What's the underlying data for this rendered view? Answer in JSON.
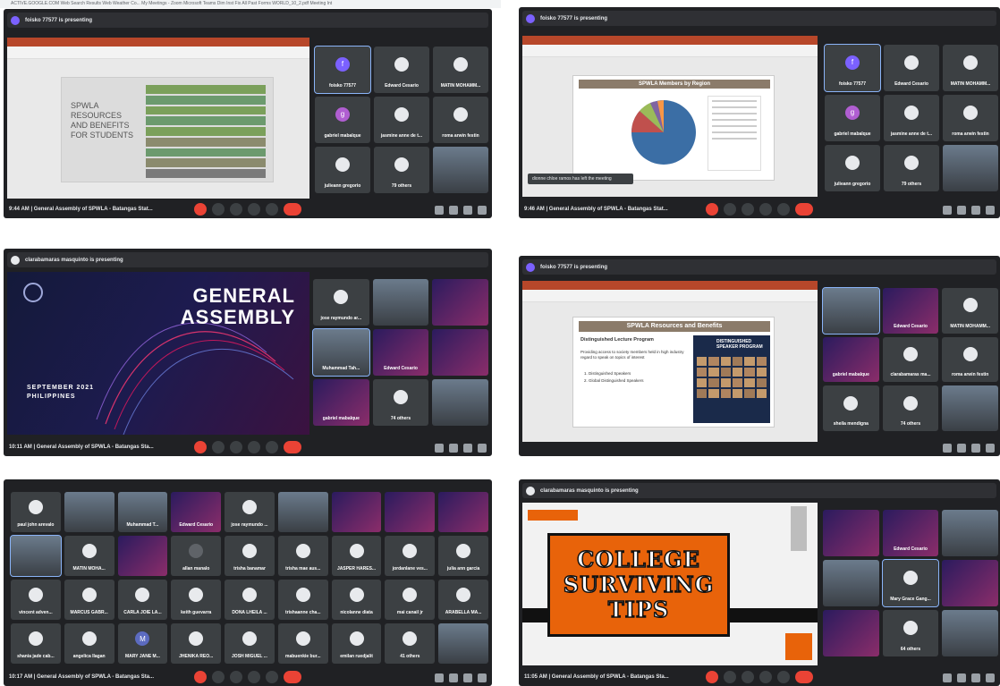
{
  "bookmarks_bar": {
    "text": "ACTIVE.GOOGLE.COM    Web Search Results    Web Weather Co...    My Meetings - Zoom    Microsoft Teams    Dim Inst    Fix All Past Forms    WORLD_10_2.pdf    Meeting Int"
  },
  "panels": [
    {
      "presenter": "foisko 77577 is presenting",
      "time_title": "9:44 AM  |  General Assembly of SPWLA - Batangas Stat...",
      "slide_title": "SPWLA RESOURCES AND BENEFITS FOR STUDENTS",
      "participants": [
        {
          "name": "foisko 77577",
          "letter": "f"
        },
        {
          "name": "Edward Cesario"
        },
        {
          "name": "MATIN MOHAMM..."
        },
        {
          "name": "gabriel mabalque",
          "letter": "g"
        },
        {
          "name": "jasmine anne de t..."
        },
        {
          "name": "roma arwin festin"
        },
        {
          "name": "julieann gregorio"
        },
        {
          "name": "79 others"
        },
        {
          "name": ""
        }
      ]
    },
    {
      "presenter": "foisko 77577 is presenting",
      "time_title": "9:46 AM  |  General Assembly of SPWLA - Batangas Stat...",
      "slide_title": "SPWLA Members by Region",
      "snackbar": "dionne chloe ramos has left the meeting",
      "participants": [
        {
          "name": "foisko 77577",
          "letter": "f"
        },
        {
          "name": "Edward Cesario"
        },
        {
          "name": "MATIN MOHAMM..."
        },
        {
          "name": "gabriel mabalque",
          "letter": "g"
        },
        {
          "name": "jasmine anne de t..."
        },
        {
          "name": "roma arwin festin"
        },
        {
          "name": "julieann gregorio"
        },
        {
          "name": "79 others"
        },
        {
          "name": ""
        }
      ]
    },
    {
      "presenter": "clarabamaras masquinto is presenting",
      "time_title": "10:11 AM  |  General Assembly of SPWLA - Batangas Sta...",
      "slide_title_1": "GENERAL",
      "slide_title_2": "ASSEMBLY",
      "slide_date": "SEPTEMBER 2021",
      "slide_place": "PHILIPPINES",
      "participants": [
        {
          "name": "jose raymundo ar..."
        },
        {
          "name": ""
        },
        {
          "name": ""
        },
        {
          "name": "Muhammad Tah..."
        },
        {
          "name": "Edward Cesario"
        },
        {
          "name": ""
        },
        {
          "name": "gabriel mabalque"
        },
        {
          "name": "74 others"
        },
        {
          "name": ""
        }
      ]
    },
    {
      "presenter": "foisko 77577 is presenting",
      "time_title": "",
      "slide_title": "SPWLA Resources and Benefits",
      "slide_subtitle": "Distinguished Lecture Program",
      "slide_body": "Providing access to society members held in high industry regard to speak on topics of interest",
      "slide_items": [
        "1. Distinguished Speakers",
        "2. Global Distinguished Speakers"
      ],
      "slide_image_title": "DISTINGUISHED SPEAKER PROGRAM",
      "participants": [
        {
          "name": ""
        },
        {
          "name": "Edward Cesario"
        },
        {
          "name": "MATIN MOHAMM..."
        },
        {
          "name": "gabriel mabalque"
        },
        {
          "name": "clarabamaras ma..."
        },
        {
          "name": "roma arwin festin"
        },
        {
          "name": "sheila mendigna"
        },
        {
          "name": "74 others"
        },
        {
          "name": ""
        }
      ]
    },
    {
      "presenter": "",
      "time_title": "10:17 AM  |  General Assembly of SPWLA - Batangas Sta...",
      "participants": [
        {
          "name": "paul john arevalo"
        },
        {
          "name": ""
        },
        {
          "name": "Muhammad T..."
        },
        {
          "name": "Edward Cesario"
        },
        {
          "name": "jose raymundo ..."
        },
        {
          "name": ""
        },
        {
          "name": ""
        },
        {
          "name": ""
        },
        {
          "name": ""
        },
        {
          "name": ""
        },
        {
          "name": "MATIN MOHA..."
        },
        {
          "name": ""
        },
        {
          "name": "allan manalo"
        },
        {
          "name": "trisha banamar"
        },
        {
          "name": "trisha mae aus..."
        },
        {
          "name": "JASPER HARES..."
        },
        {
          "name": "jordanlane ves..."
        },
        {
          "name": "julia ann garcia"
        },
        {
          "name": "vincent adven..."
        },
        {
          "name": "MARCUS GABR..."
        },
        {
          "name": "CARLA JOIE LA..."
        },
        {
          "name": "keith guevarra"
        },
        {
          "name": "DONA LHEILA ..."
        },
        {
          "name": "trishaanne cha..."
        },
        {
          "name": "nicolanne diata"
        },
        {
          "name": "mai canail jr"
        },
        {
          "name": "ARABELLA MA..."
        },
        {
          "name": "shania jade cab..."
        },
        {
          "name": "angelica llagan"
        },
        {
          "name": "MARY JANE M...",
          "letter": "M"
        },
        {
          "name": "JHENIKA REO..."
        },
        {
          "name": "JOSH MIGUEL ..."
        },
        {
          "name": "mabuenkie bur..."
        },
        {
          "name": "emilan ruedjalit"
        },
        {
          "name": "41 others"
        },
        {
          "name": ""
        }
      ]
    },
    {
      "presenter": "clarabamaras masquinto is presenting",
      "time_title": "11:05 AM  |  General Assembly of SPWLA - Batangas Sta...",
      "slide_line1": "COLLEGE",
      "slide_line2": "SURVIVING",
      "slide_line3": "TIPS",
      "participants": [
        {
          "name": ""
        },
        {
          "name": "Edward Cesario"
        },
        {
          "name": ""
        },
        {
          "name": ""
        },
        {
          "name": "Mary Grace Gang..."
        },
        {
          "name": ""
        },
        {
          "name": ""
        },
        {
          "name": "64 others"
        },
        {
          "name": ""
        }
      ]
    }
  ],
  "colors": {
    "meet_bg": "#202124",
    "tile_bg": "#3c4043",
    "end_call": "#ea4335",
    "ppt_accent": "#b7472a",
    "college_orange": "#e8630a"
  }
}
